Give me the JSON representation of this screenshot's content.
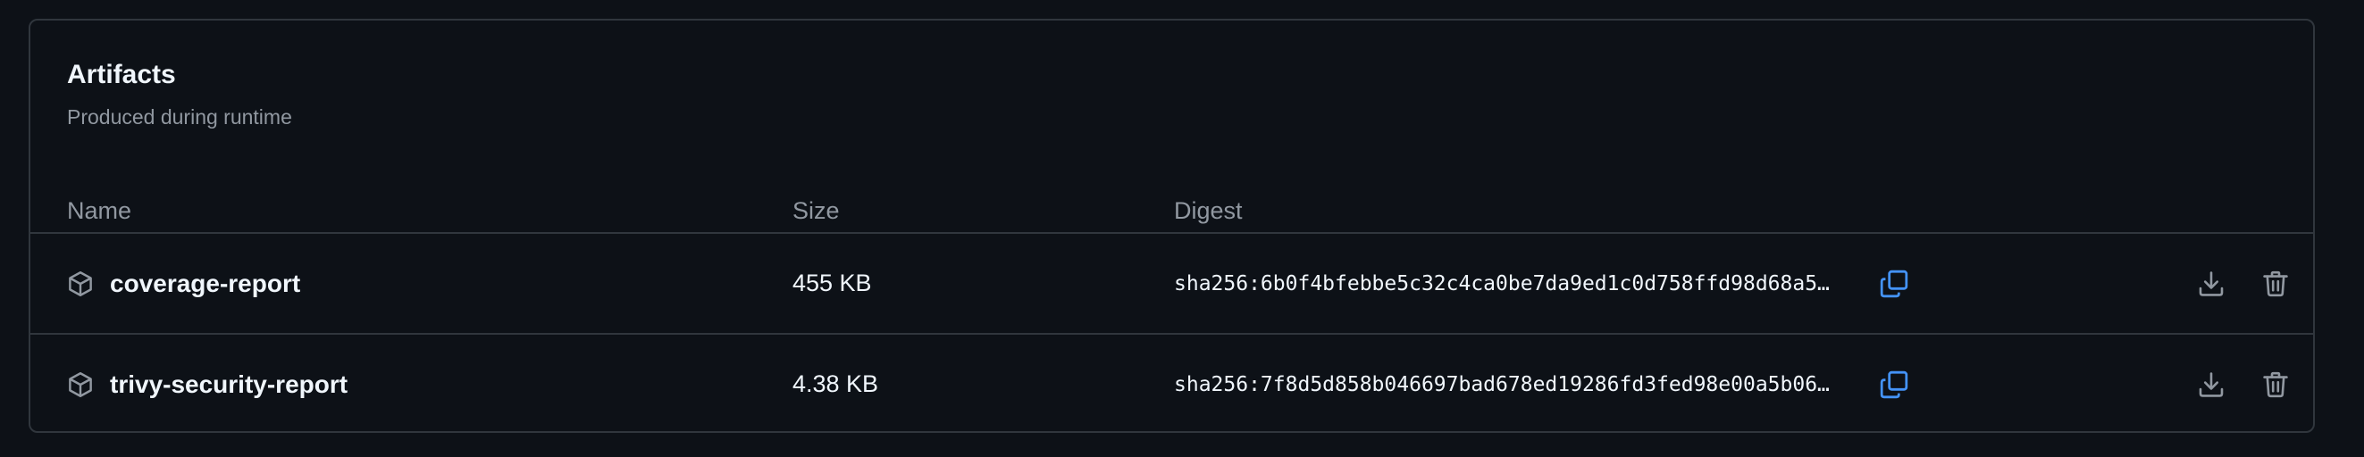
{
  "artifacts": {
    "title": "Artifacts",
    "subtitle": "Produced during runtime",
    "columns": {
      "name": "Name",
      "size": "Size",
      "digest": "Digest"
    },
    "rows": [
      {
        "name": "coverage-report",
        "size": "455 KB",
        "digest": "sha256:6b0f4bfebbe5c32c4ca0be7da9ed1c0d758ffd98d68a5…"
      },
      {
        "name": "trivy-security-report",
        "size": "4.38 KB",
        "digest": "sha256:7f8d5d858b046697bad678ed19286fd3fed98e00a5b06…"
      }
    ],
    "icons": {
      "package": "package-icon",
      "copy": "copy-icon",
      "download": "download-icon",
      "delete": "trash-icon"
    },
    "colors": {
      "background": "#0d1117",
      "border": "#30363d",
      "muted_text": "#9198a1",
      "primary_text": "#f0f6fc",
      "copy_accent": "#4493f8",
      "icon_gray": "#9198a1"
    }
  }
}
